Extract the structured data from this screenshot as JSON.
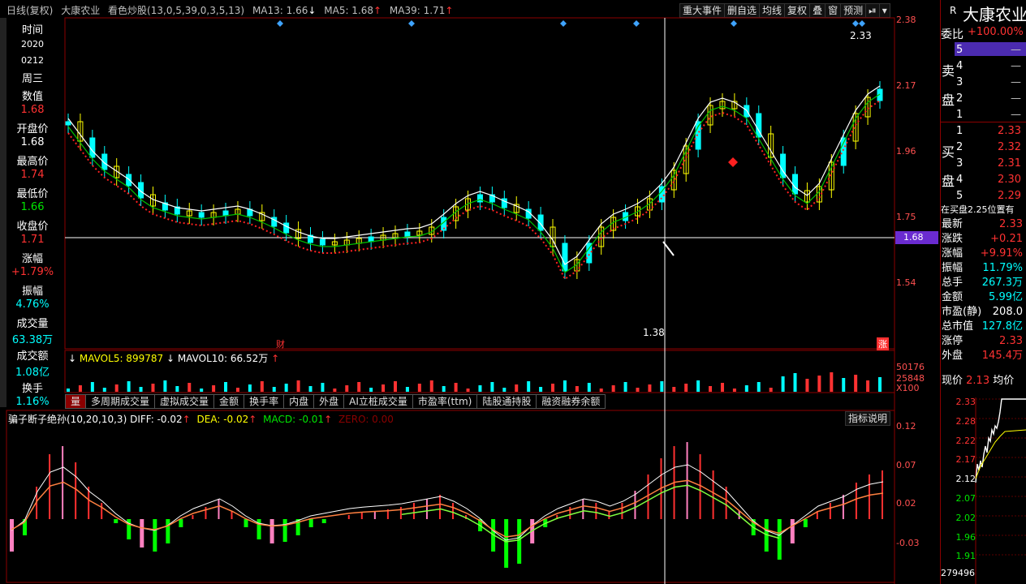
{
  "header": {
    "period": "日线(复权)",
    "stock": "大康农业",
    "indicator": "看色炒股(13,0,5,39,0,3,5,13)",
    "ma13": "MA13: 1.66",
    "ma5": "MA5: 1.68",
    "ma39": "MA39: 1.71",
    "buttons": [
      "重大事件",
      "删自选",
      "均线",
      "复权",
      "叠",
      "窗",
      "预测"
    ]
  },
  "left_panel": [
    {
      "label": "时间",
      "value": "2020"
    },
    {
      "label": "0212",
      "value": ""
    },
    {
      "label": "周三",
      "value": ""
    },
    {
      "label": "数值",
      "value": "1.68"
    },
    {
      "label": "开盘价",
      "value": "1.68"
    },
    {
      "label": "最高价",
      "value": "1.74"
    },
    {
      "label": "最低价",
      "value": "1.66"
    },
    {
      "label": "收盘价",
      "value": "1.71"
    },
    {
      "label": "涨幅",
      "value": "+1.79%"
    },
    {
      "label": "振幅",
      "value": "4.76%"
    },
    {
      "label": "成交量",
      "value": "63.38万"
    },
    {
      "label": "成交额",
      "value": "1.08亿"
    },
    {
      "label": "换手",
      "value": "1.16%"
    }
  ],
  "price_axis": [
    "2.38",
    "2.17",
    "1.96",
    "1.75",
    "1.54"
  ],
  "crosshair_value": "1.68",
  "annotations": {
    "high": "2.33",
    "low": "1.38",
    "cai": "财",
    "zhang": "涨"
  },
  "volume": {
    "mavol5": "MAVOL5: 899787",
    "mavol10": "MAVOL10: 66.52万",
    "axis": [
      "50176",
      "25848",
      "X100"
    ]
  },
  "tabs": [
    "多周期成交量",
    "虚拟成交量",
    "金额",
    "换手率",
    "内盘",
    "外盘",
    "AI立桩成交量",
    "市盈率(ttm)",
    "陆股通持股",
    "融资融券余额"
  ],
  "macd": {
    "title": "骗子断子绝孙(10,20,10,3)",
    "diff": "DIFF: -0.02",
    "dea": "DEA: -0.02",
    "macd": "MACD: -0.01",
    "zero": "ZERO: 0.00",
    "help": "指标说明",
    "axis": [
      "0.12",
      "0.07",
      "0.02",
      "-0.03"
    ]
  },
  "right_panel": {
    "code": "R",
    "name": "大康农业",
    "webi": "委比",
    "webi_val": "+100.00%",
    "sell_label": "卖盘",
    "buy_label": "买盘",
    "sell": [
      {
        "n": "5",
        "p": "—"
      },
      {
        "n": "4",
        "p": "—"
      },
      {
        "n": "3",
        "p": "—"
      },
      {
        "n": "2",
        "p": "—"
      },
      {
        "n": "1",
        "p": "—"
      }
    ],
    "buy": [
      {
        "n": "1",
        "p": "2.33"
      },
      {
        "n": "2",
        "p": "2.32"
      },
      {
        "n": "3",
        "p": "2.31"
      },
      {
        "n": "4",
        "p": "2.30"
      },
      {
        "n": "5",
        "p": "2.29"
      }
    ],
    "note": "在买盘2.25位置有",
    "stats": [
      {
        "k": "最新",
        "v": "2.33"
      },
      {
        "k": "涨跌",
        "v": "+0.21"
      },
      {
        "k": "涨幅",
        "v": "+9.91%"
      },
      {
        "k": "振幅",
        "v": "11.79%"
      },
      {
        "k": "总手",
        "v": "267.3万"
      },
      {
        "k": "金额",
        "v": "5.99亿"
      },
      {
        "k": "市盈(静)",
        "v": "208.0"
      },
      {
        "k": "总市值",
        "v": "127.8亿"
      },
      {
        "k": "涨停",
        "v": "2.33"
      },
      {
        "k": "外盘",
        "v": "145.4万"
      }
    ],
    "price_label": "现价",
    "price_val": "2.13",
    "avg_label": "均价",
    "mini_axis": [
      "2.33",
      "2.28",
      "2.22",
      "2.17",
      "2.12",
      "2.07",
      "2.02",
      "1.96",
      "1.91"
    ],
    "mini_vol": "279496"
  }
}
